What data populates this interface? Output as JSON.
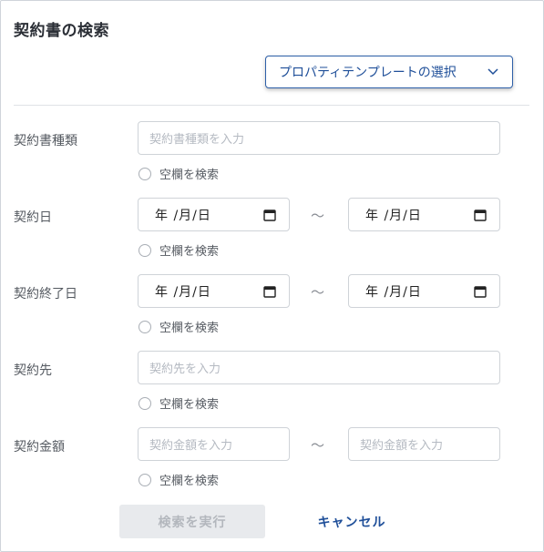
{
  "title": "契約書の検索",
  "property_template_button": "プロパティテンプレートの選択",
  "blank_search_label": "空欄を検索",
  "fields": {
    "type": {
      "label": "契約書種類",
      "placeholder": "契約書種類を入力"
    },
    "date": {
      "label": "契約日",
      "from": "年 /月/日",
      "to": "年 /月/日"
    },
    "end_date": {
      "label": "契約終了日",
      "from": "年 /月/日",
      "to": "年 /月/日"
    },
    "party": {
      "label": "契約先",
      "placeholder": "契約先を入力"
    },
    "amount": {
      "label": "契約金額",
      "from_placeholder": "契約金額を入力",
      "to_placeholder": "契約金額を入力"
    }
  },
  "range_separator": "～",
  "actions": {
    "execute": "検索を実行",
    "cancel": "キャンセル"
  },
  "colors": {
    "accent": "#1f4f99",
    "border": "#cfd3d8",
    "placeholder": "#b5bac2",
    "disabled_bg": "#e8eaed"
  },
  "icons": {
    "dropdown": "chevron-down-icon",
    "date": "calendar-icon",
    "radio": "radio-icon"
  }
}
